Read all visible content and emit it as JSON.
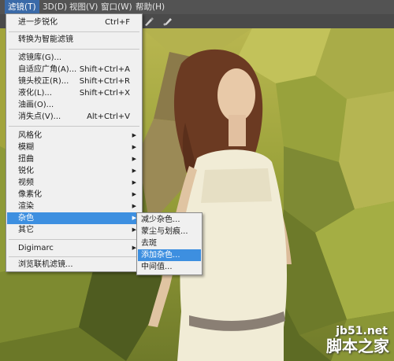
{
  "menubar": {
    "items": [
      {
        "label": "滤镜(T)",
        "active": true
      },
      {
        "label": "3D(D)"
      },
      {
        "label": "视图(V)"
      },
      {
        "label": "窗口(W)"
      },
      {
        "label": "帮助(H)"
      }
    ]
  },
  "filter_menu": {
    "items": [
      {
        "label": "进一步锐化",
        "shortcut": "Ctrl+F"
      },
      {
        "label": "转换为智能滤镜"
      },
      {
        "label": "滤镜库(G)..."
      },
      {
        "label": "自适应广角(A)...",
        "shortcut": "Shift+Ctrl+A"
      },
      {
        "label": "镜头校正(R)...",
        "shortcut": "Shift+Ctrl+R"
      },
      {
        "label": "液化(L)...",
        "shortcut": "Shift+Ctrl+X"
      },
      {
        "label": "油画(O)..."
      },
      {
        "label": "消失点(V)...",
        "shortcut": "Alt+Ctrl+V"
      },
      {
        "label": "风格化"
      },
      {
        "label": "模糊"
      },
      {
        "label": "扭曲"
      },
      {
        "label": "锐化"
      },
      {
        "label": "视频"
      },
      {
        "label": "像素化"
      },
      {
        "label": "渲染"
      },
      {
        "label": "杂色"
      },
      {
        "label": "其它"
      },
      {
        "label": "Digimarc"
      },
      {
        "label": "浏览联机滤镜..."
      }
    ]
  },
  "noise_submenu": {
    "items": [
      {
        "label": "减少杂色..."
      },
      {
        "label": "蒙尘与划痕..."
      },
      {
        "label": "去斑"
      },
      {
        "label": "添加杂色..."
      },
      {
        "label": "中间值..."
      }
    ]
  },
  "watermark": {
    "url": "jb51.net",
    "name": "脚本之家"
  },
  "icons": {
    "options_bar": [
      "brush-icon",
      "pen-icon"
    ],
    "submenu_arrow": "triangle-right-icon"
  }
}
